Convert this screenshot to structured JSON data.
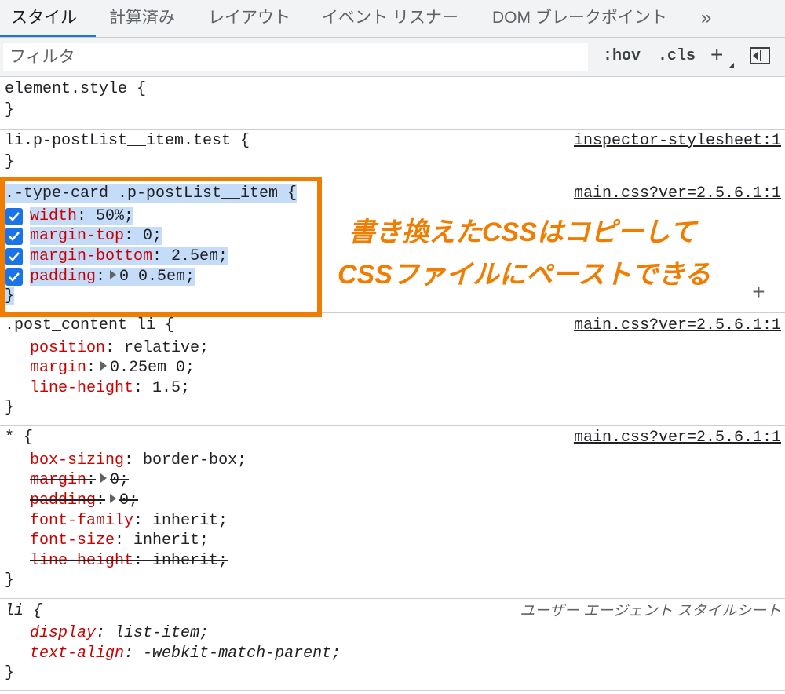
{
  "tabs": [
    "スタイル",
    "計算済み",
    "レイアウト",
    "イベント リスナー",
    "DOM ブレークポイント"
  ],
  "tabs_more": "»",
  "filter": {
    "placeholder": "フィルタ",
    "hov": ":hov",
    "cls": ".cls",
    "plus": "+"
  },
  "rules": {
    "r0": {
      "selector": "element.style {",
      "close": "}"
    },
    "r1": {
      "selector": "li.p-postList__item.test {",
      "source": "inspector-stylesheet:1",
      "close": "}"
    },
    "r2": {
      "selector": ".-type-card .p-postList__item {",
      "source": "main.css?ver=2.5.6.1:1",
      "decls": [
        {
          "prop": "width",
          "value": "50%;"
        },
        {
          "prop": "margin-top",
          "value": "0;"
        },
        {
          "prop": "margin-bottom",
          "value": "2.5em;"
        },
        {
          "prop": "padding",
          "value": "0 0.5em;"
        }
      ],
      "close": "}",
      "add": "+"
    },
    "r3": {
      "selector": ".post_content li {",
      "source": "main.css?ver=2.5.6.1:1",
      "decls": [
        {
          "prop": "position",
          "value": "relative;"
        },
        {
          "prop": "margin",
          "value": "0.25em 0;"
        },
        {
          "prop": "line-height",
          "value": "1.5;"
        }
      ],
      "close": "}"
    },
    "r4": {
      "selector": "* {",
      "source": "main.css?ver=2.5.6.1:1",
      "decls": [
        {
          "prop": "box-sizing",
          "value": "border-box;"
        },
        {
          "prop": "margin",
          "value": "0;"
        },
        {
          "prop": "padding",
          "value": "0;"
        },
        {
          "prop": "font-family",
          "value": "inherit;"
        },
        {
          "prop": "font-size",
          "value": "inherit;"
        },
        {
          "prop": "line-height",
          "value": "inherit;"
        }
      ],
      "close": "}"
    },
    "r5": {
      "selector": "li {",
      "source": "ユーザー エージェント スタイルシート",
      "decls": [
        {
          "prop": "display",
          "value": "list-item;"
        },
        {
          "prop": "text-align",
          "value": "-webkit-match-parent;"
        }
      ],
      "close": "}"
    }
  },
  "annotation": {
    "line1": "書き換えたCSSはコピーして",
    "line2": "CSSファイルにペーストできる",
    "color": "#f07d00"
  },
  "colors": {
    "property": "#c80000",
    "checkbox": "#1a73e8",
    "selection": "#c5dcf8"
  }
}
